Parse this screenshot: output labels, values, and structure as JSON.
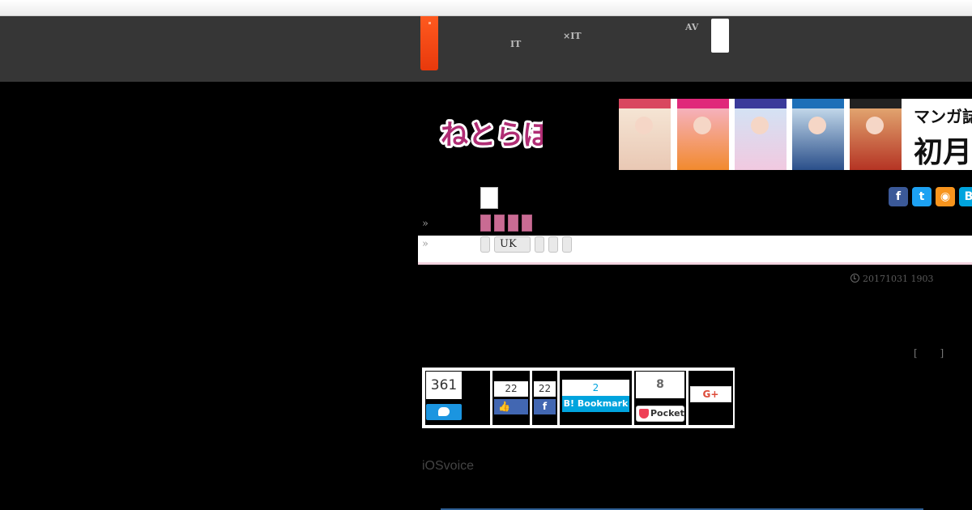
{
  "nav": {
    "items": [
      {
        "line1": "　　",
        "line2": "IT"
      },
      {
        "line1": "　　　",
        "line2": "×IT"
      },
      {
        "line1": "AV",
        "line2": "　　"
      }
    ]
  },
  "logo": {
    "text": "ねとらぼ",
    "color": "#b02d74"
  },
  "banner": {
    "line1": "マンガ誌",
    "line2": "初月"
  },
  "social": {
    "icons": [
      {
        "name": "facebook-icon",
        "glyph": "f",
        "color": "#3b5998"
      },
      {
        "name": "twitter-icon",
        "glyph": "t",
        "color": "#1da1f2"
      },
      {
        "name": "rss-icon",
        "glyph": "◉",
        "color": "#f7941d"
      },
      {
        "name": "hatena-icon",
        "glyph": "B",
        "color": "#00a4de"
      }
    ]
  },
  "breadcrumb": {
    "arrow": "»"
  },
  "tags": {
    "uk_label": "UK"
  },
  "article": {
    "date": "20171031 1903",
    "brackets": "[ ]",
    "source": "iOSvoice"
  },
  "share": {
    "twitter_count": "361",
    "facebook_like_count": "22",
    "facebook_share_count": "22",
    "hatena_count": "2",
    "hatena_label": "B! Bookmark",
    "pocket_count": "8",
    "pocket_label": "Pocket",
    "gplus_label": "G+"
  },
  "colors": {
    "nav_bg": "#363636",
    "home_accent": "#ff4b14",
    "twitter": "#1b95e0",
    "facebook": "#4267b2",
    "hatena": "#00a4de",
    "pocket": "#ef4056",
    "gplus": "#dd4b39"
  }
}
